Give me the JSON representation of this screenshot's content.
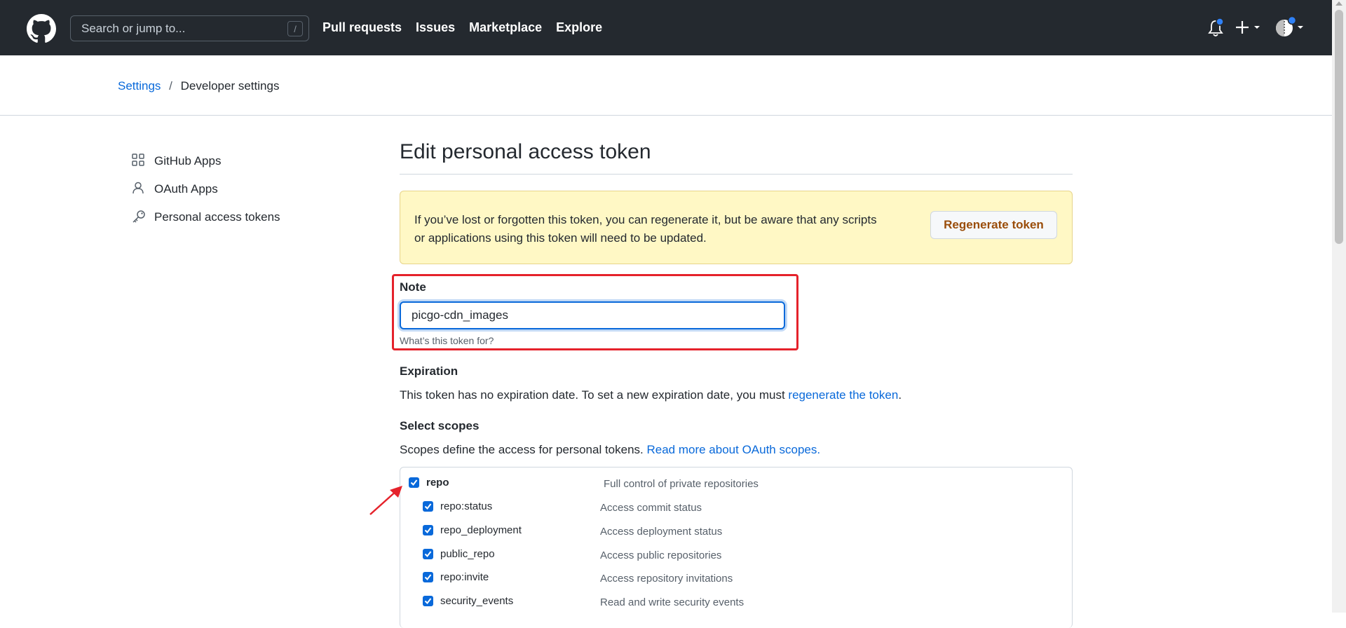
{
  "header": {
    "search_placeholder": "Search or jump to...",
    "search_shortcut": "/",
    "nav": [
      "Pull requests",
      "Issues",
      "Marketplace",
      "Explore"
    ]
  },
  "breadcrumb": {
    "settings": "Settings",
    "separator": "/",
    "current": "Developer settings"
  },
  "sidebar": {
    "items": [
      {
        "label": "GitHub Apps",
        "icon": "apps-icon"
      },
      {
        "label": "OAuth Apps",
        "icon": "person-icon"
      },
      {
        "label": "Personal access tokens",
        "icon": "key-icon"
      }
    ]
  },
  "main": {
    "title": "Edit personal access token",
    "warning_line1": "If you’ve lost or forgotten this token, you can regenerate it, but be aware that any scripts",
    "warning_line2": "or applications using this token will need to be updated.",
    "regenerate_button": "Regenerate token",
    "note_label": "Note",
    "note_value": "picgo-cdn_images",
    "note_help": "What’s this token for?",
    "expiration_label": "Expiration",
    "expiration_text": "This token has no expiration date. To set a new expiration date, you must ",
    "expiration_link": "regenerate the token",
    "expiration_end": ".",
    "scopes_label": "Select scopes",
    "scopes_text": "Scopes define the access for personal tokens. ",
    "scopes_link": "Read more about OAuth scopes.",
    "scopes": [
      {
        "name": "repo",
        "desc": "Full control of private repositories",
        "checked": true
      },
      {
        "name": "repo:status",
        "desc": "Access commit status",
        "checked": true
      },
      {
        "name": "repo_deployment",
        "desc": "Access deployment status",
        "checked": true
      },
      {
        "name": "public_repo",
        "desc": "Access public repositories",
        "checked": true
      },
      {
        "name": "repo:invite",
        "desc": "Access repository invitations",
        "checked": true
      },
      {
        "name": "security_events",
        "desc": "Read and write security events",
        "checked": true
      }
    ]
  },
  "colors": {
    "header_bg": "#24292f",
    "link": "#0969da",
    "highlight": "#e5222b",
    "warning_bg": "#fff8c5"
  }
}
